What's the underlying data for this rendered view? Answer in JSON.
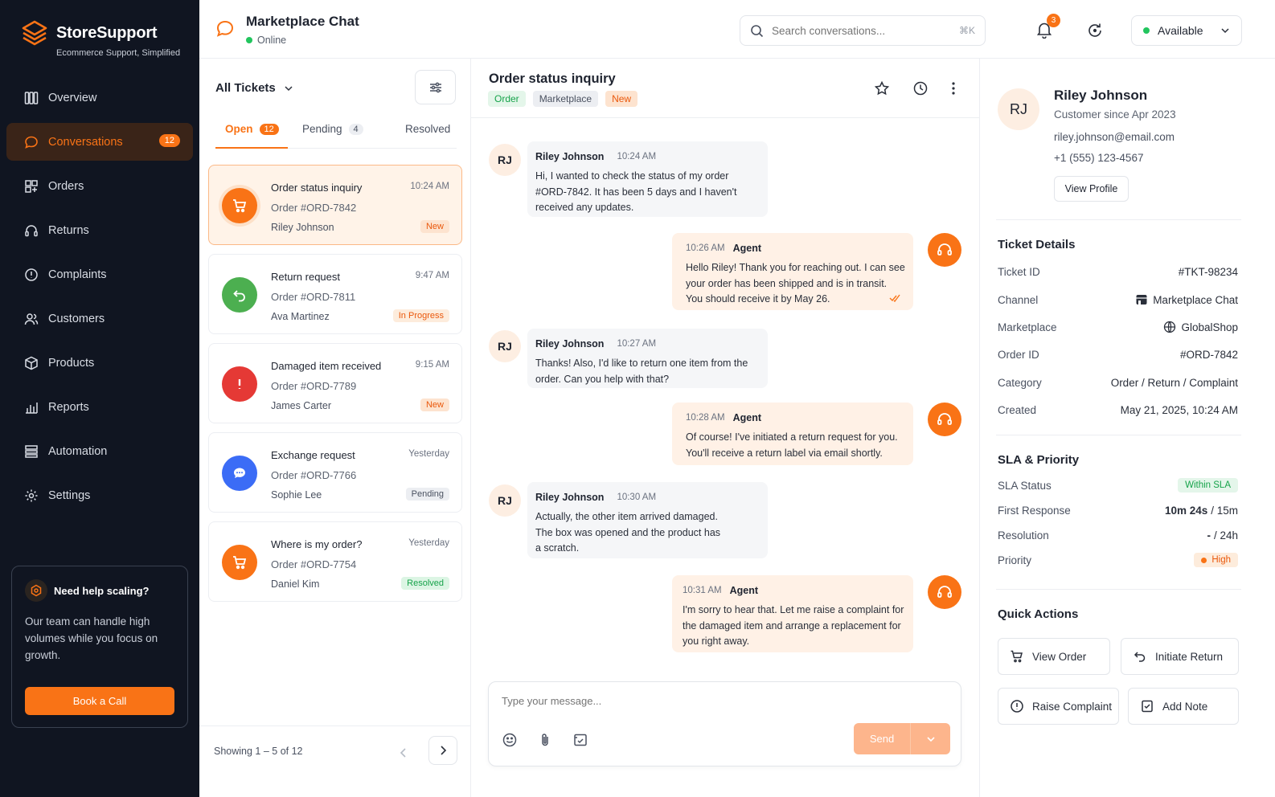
{
  "brand": {
    "name": "StoreSupport",
    "tagline": "Ecommerce Support, Simplified",
    "color": "#f97316"
  },
  "sidebar": {
    "items": [
      {
        "label": "Overview",
        "icon": "grid-icon"
      },
      {
        "label": "Conversations",
        "icon": "chat-icon",
        "badge": "12",
        "active": true
      },
      {
        "label": "Orders",
        "icon": "orders-icon"
      },
      {
        "label": "Returns",
        "icon": "return-icon"
      },
      {
        "label": "Complaints",
        "icon": "alert-icon"
      },
      {
        "label": "Customers",
        "icon": "users-icon"
      },
      {
        "label": "Products",
        "icon": "box-icon"
      },
      {
        "label": "Reports",
        "icon": "bar-chart-icon"
      },
      {
        "label": "Automation",
        "icon": "automation-icon"
      },
      {
        "label": "Settings",
        "icon": "gear-icon"
      }
    ],
    "help": {
      "title": "Need help scaling?",
      "text": "Our team can handle high volumes while you focus on growth.",
      "button": "Book a Call"
    }
  },
  "header": {
    "title": "Marketplace Chat",
    "status": "Online",
    "search_placeholder": "Search conversations...",
    "search_shortcut": "⌘K",
    "notifications": "3",
    "availability": "Available"
  },
  "tickets": {
    "filter_label": "All Tickets",
    "tabs": [
      {
        "label": "Open",
        "count": "12"
      },
      {
        "label": "Pending",
        "count": "4"
      },
      {
        "label": "Resolved",
        "count": ""
      }
    ],
    "items": [
      {
        "title": "Order status inquiry",
        "order": "Order #ORD-7842",
        "name": "Riley Johnson",
        "time": "10:24 AM",
        "status": "New",
        "icon": "cart-icon"
      },
      {
        "title": "Return request",
        "order": "Order #ORD-7811",
        "name": "Ava Martinez",
        "time": "9:47 AM",
        "status": "In Progress",
        "icon": "return-icon"
      },
      {
        "title": "Damaged item received",
        "order": "Order #ORD-7789",
        "name": "James Carter",
        "time": "9:15 AM",
        "status": "New",
        "icon": "exclamation-icon"
      },
      {
        "title": "Exchange request",
        "order": "Order #ORD-7766",
        "name": "Sophie Lee",
        "time": "Yesterday",
        "status": "Pending",
        "icon": "chat-bubble-icon"
      },
      {
        "title": "Where is my order?",
        "order": "Order #ORD-7754",
        "name": "Daniel Kim",
        "time": "Yesterday",
        "status": "Resolved",
        "icon": "cart-icon"
      }
    ],
    "pager_text": "Showing 1 – 5 of 12"
  },
  "chat": {
    "title": "Order status inquiry",
    "tags": [
      "Order",
      "Marketplace",
      "New"
    ],
    "messages": [
      {
        "from": "customer",
        "initials": "RJ",
        "name": "Riley Johnson",
        "time": "10:24 AM",
        "text": "Hi, I wanted to check the status of my order #ORD-7842. It has been 5 days and I haven't received any updates."
      },
      {
        "from": "agent",
        "name": "Agent",
        "time": "10:26 AM",
        "text": "Hello Riley! Thank you for reaching out. I can see your order has been shipped and is in transit. You should receive it by May 26."
      },
      {
        "from": "customer",
        "initials": "RJ",
        "name": "Riley Johnson",
        "time": "10:27 AM",
        "text": "Thanks! Also, I'd like to return one item from the order. Can you help with that?"
      },
      {
        "from": "agent",
        "name": "Agent",
        "time": "10:28 AM",
        "text": "Of course! I've initiated a return request for you. You'll receive a return label via email shortly."
      },
      {
        "from": "customer",
        "initials": "RJ",
        "name": "Riley Johnson",
        "time": "10:30 AM",
        "text": "Actually, the other item arrived damaged. The box was opened and the product has a scratch."
      },
      {
        "from": "agent",
        "name": "Agent",
        "time": "10:31 AM",
        "text": "I'm sorry to hear that. Let me raise a complaint for the damaged item and arrange a replacement for you right away."
      }
    ],
    "composer_placeholder": "Type your message...",
    "send_label": "Send"
  },
  "customer": {
    "initials": "RJ",
    "name": "Riley Johnson",
    "since": "Customer since Apr 2023",
    "email": "riley.johnson@email.com",
    "phone": "+1 (555) 123-4567",
    "view_profile": "View Profile"
  },
  "ticket_details": {
    "title": "Ticket Details",
    "rows": [
      {
        "k": "Ticket ID",
        "v": "#TKT-98234"
      },
      {
        "k": "Channel",
        "v": "Marketplace Chat"
      },
      {
        "k": "Marketplace",
        "v": "GlobalShop"
      },
      {
        "k": "Order ID",
        "v": "#ORD-7842"
      },
      {
        "k": "Category",
        "v": "Order / Return / Complaint"
      },
      {
        "k": "Created",
        "v": "May 21, 2025, 10:24 AM"
      }
    ]
  },
  "sla": {
    "title": "SLA & Priority",
    "status_label": "SLA Status",
    "status_value": "Within SLA",
    "first_label": "First Response",
    "first_value": "10m 24s",
    "first_target": "/ 15m",
    "resolution_label": "Resolution",
    "resolution_value": "-",
    "resolution_target": "/ 24h",
    "priority_label": "Priority",
    "priority_value": "High"
  },
  "quick_actions": {
    "title": "Quick Actions",
    "items": [
      "View Order",
      "Initiate Return",
      "Raise Complaint",
      "Add Note"
    ]
  }
}
